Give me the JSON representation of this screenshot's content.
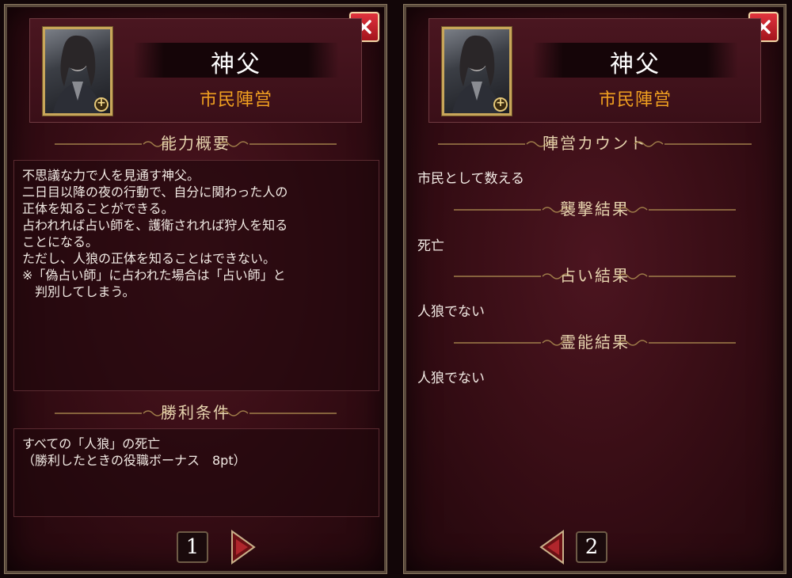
{
  "left_panel": {
    "role_name": "神父",
    "faction": "市民陣営",
    "ability_title": "能力概要",
    "ability_lines": [
      "不思議な力で人を見通す神父。",
      "二日目以降の夜の行動で、自分に関わった人の",
      "正体を知ることができる。",
      "占われれば占い師を、護衛されれば狩人を知る",
      "ことになる。",
      "ただし、人狼の正体を知ることはできない。",
      "※「偽占い師」に占われた場合は「占い師」と",
      "　判別してしまう。"
    ],
    "victory_title": "勝利条件",
    "victory_lines": [
      "すべての「人狼」の死亡",
      "（勝利したときの役職ボーナス　8pt）"
    ],
    "page_number": "1"
  },
  "right_panel": {
    "role_name": "神父",
    "faction": "市民陣営",
    "sections": [
      {
        "title": "陣営カウント",
        "value": "市民として数える"
      },
      {
        "title": "襲撃結果",
        "value": "死亡"
      },
      {
        "title": "占い結果",
        "value": "人狼でない"
      },
      {
        "title": "霊能結果",
        "value": "人狼でない"
      }
    ],
    "page_number": "2"
  },
  "icons": {
    "close": "close-icon",
    "zoom": "zoom-in-icon",
    "next": "arrow-right-icon",
    "prev": "arrow-left-icon"
  },
  "colors": {
    "faction": "#f0a020",
    "close_button": "#c8202a",
    "panel_bg": "#3a0e16",
    "title_text": "#e6d3ae"
  }
}
